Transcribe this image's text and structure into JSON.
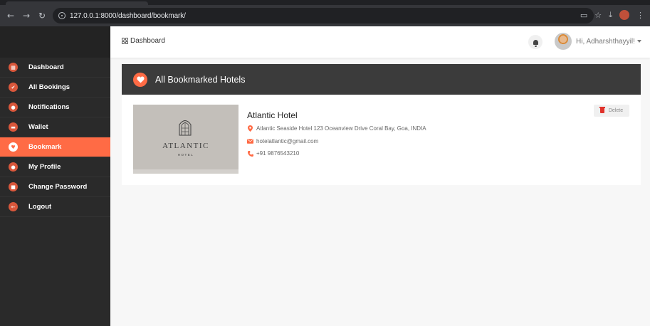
{
  "browser": {
    "url_host": "127.0.0.1:8000",
    "url_path": "/dashboard/bookmark/",
    "back_icon": "arrow-left-icon",
    "forward_icon": "arrow-right-icon",
    "reload_icon": "reload-icon"
  },
  "header": {
    "breadcrumb": "Dashboard",
    "greeting": "Hi, Adharshthayyil!"
  },
  "sidebar": {
    "items": [
      {
        "label": "Dashboard",
        "icon": "grid-icon",
        "glyph": "▦"
      },
      {
        "label": "All Bookings",
        "icon": "check-icon",
        "glyph": "✔"
      },
      {
        "label": "Notifications",
        "icon": "bell-icon",
        "glyph": "●"
      },
      {
        "label": "Wallet",
        "icon": "wallet-icon",
        "glyph": "▬"
      },
      {
        "label": "Bookmark",
        "icon": "heart-icon",
        "glyph": "♥",
        "active": true
      },
      {
        "label": "My Profile",
        "icon": "user-icon",
        "glyph": "●"
      },
      {
        "label": "Change Password",
        "icon": "lock-icon",
        "glyph": "■"
      },
      {
        "label": "Logout",
        "icon": "logout-icon",
        "glyph": "←"
      }
    ]
  },
  "main": {
    "title": "All Bookmarked Hotels",
    "hotel": {
      "name": "Atlantic Hotel",
      "address": "Atlantic Seaside Hotel 123 Oceanview Drive Coral Bay, Goa, INDIA",
      "email": "hotelatlantic@gmail.com",
      "phone": "+91 9876543210",
      "image_brand": "ATLANTIC",
      "image_sub": "HOTEL"
    },
    "delete_label": "Delete"
  },
  "colors": {
    "accent": "#ff6b45",
    "sidebar_bg": "#2a2a2a",
    "card_header_bg": "#3b3b3b",
    "delete_icon": "#e0322b"
  }
}
